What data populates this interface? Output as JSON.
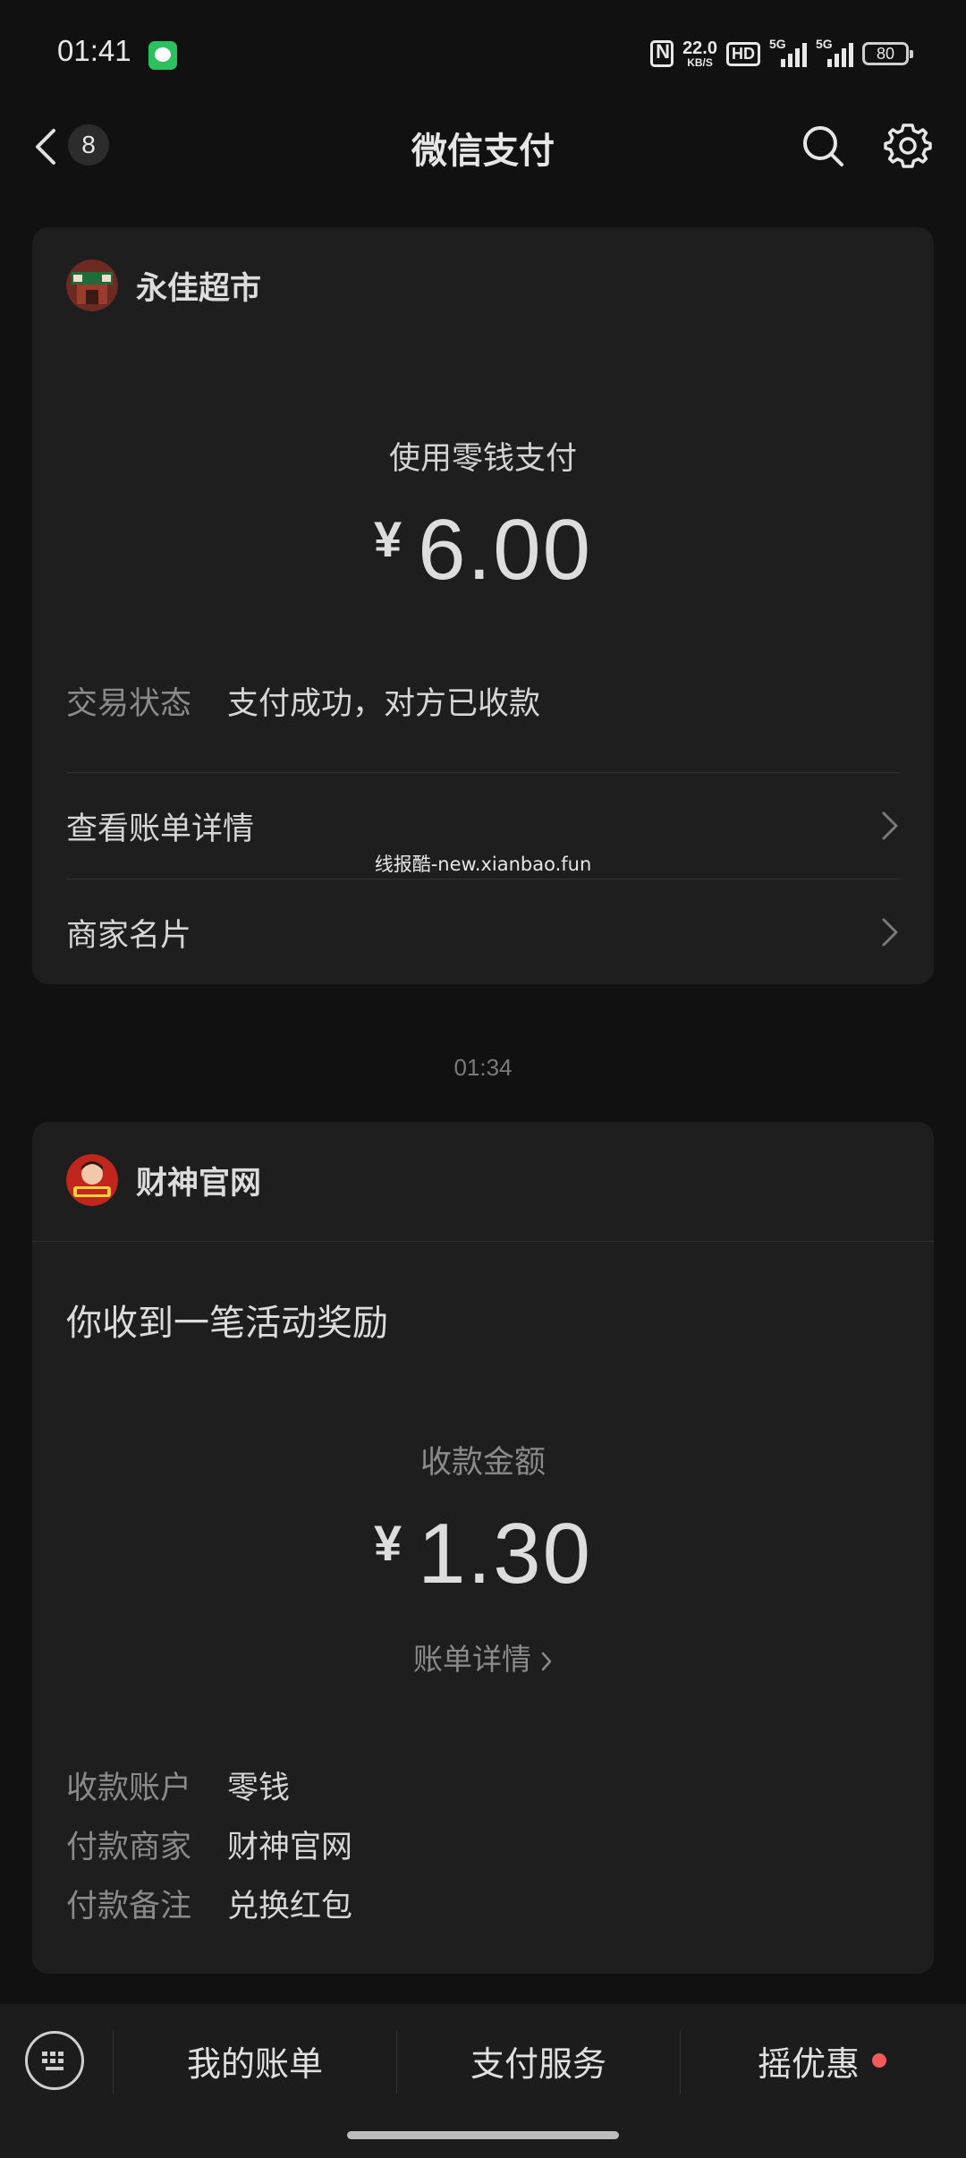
{
  "status_bar": {
    "time": "01:41",
    "net_speed": "22.0",
    "net_speed_unit": "KB/S",
    "hd_label": "HD",
    "signal_1_label": "5G",
    "signal_2_label": "5G",
    "battery": "80"
  },
  "nav": {
    "badge_count": "8",
    "title": "微信支付"
  },
  "payment_card": {
    "merchant_name": "永佳超市",
    "method_label": "使用零钱支付",
    "currency": "¥",
    "amount": "6.00",
    "status_key": "交易状态",
    "status_value": "支付成功，对方已收款",
    "link_bill_details": "查看账单详情",
    "link_merchant_card": "商家名片"
  },
  "watermark": "线报酷-new.xianbao.fun",
  "timestamp": "01:34",
  "reward_card": {
    "merchant_name": "财神官网",
    "notice": "你收到一笔活动奖励",
    "amount_label": "收款金额",
    "currency": "¥",
    "amount": "1.30",
    "detail_link": "账单详情",
    "rows": [
      {
        "key": "收款账户",
        "value": "零钱"
      },
      {
        "key": "付款商家",
        "value": "财神官网"
      },
      {
        "key": "付款备注",
        "value": "兑换红包"
      }
    ]
  },
  "bottom_bar": {
    "tabs": [
      {
        "label": "我的账单"
      },
      {
        "label": "支付服务"
      },
      {
        "label": "摇优惠"
      }
    ]
  },
  "colors": {
    "background": "#111111",
    "card": "#1e1e1e",
    "badge_red": "#f35a5a",
    "wechat_green": "#2bc15f"
  }
}
